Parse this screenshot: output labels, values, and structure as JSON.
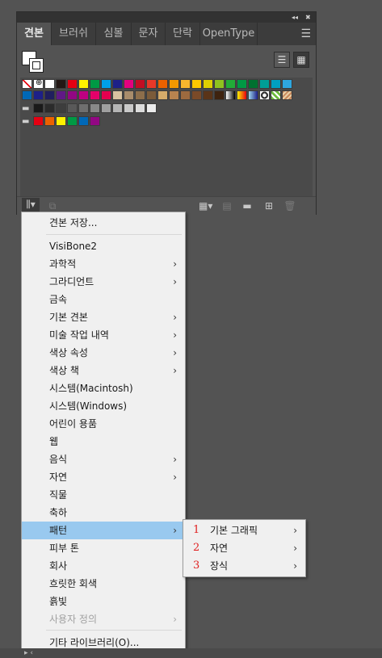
{
  "panel": {
    "tabs": [
      "견본",
      "브러쉬",
      "심볼",
      "문자",
      "단락",
      "OpenType"
    ],
    "active_tab": 0,
    "collapse_icon": "double-chevron-icon",
    "close_icon": "close-icon",
    "menu_icon": "hamburger-menu-icon",
    "swatch_rows": [
      [
        "none",
        "reg",
        "#ffffff",
        "#231815",
        "#e60012",
        "#fff100",
        "#009944",
        "#00a0e9",
        "#1d2088",
        "#e4007f",
        "#c30d23",
        "#e83828",
        "#eb6100",
        "#f39800",
        "#f8b62d",
        "#fcc800",
        "#dfd000",
        "#8fc31f",
        "#22ac38",
        "#009944",
        "#007130",
        "#009e96",
        "#00a0c1",
        "#2ea7e0"
      ],
      [
        "#0068b7",
        "#1d2088",
        "#201f5e",
        "#601986",
        "#920783",
        "#be0081",
        "#e5006a",
        "#e5004f",
        "#d9c3a0",
        "#a88c6b",
        "#8d6e4b",
        "#7b5b3a",
        "#d6ac6a",
        "#b8834f",
        "#9d6a3f",
        "#7a4a28",
        "#5a3418",
        "#3e230f",
        "grad1",
        "grad2",
        "grad3",
        "pat1",
        "pat2",
        "pat3"
      ],
      [
        "folder",
        "#1a1a1a",
        "#2b2b2b",
        "#3d3d3d",
        "#595959",
        "#6f6f6f",
        "#898989",
        "#9f9f9f",
        "#b5b5b5",
        "#c9c9c9",
        "#dcdcdc",
        "#ececec"
      ],
      [
        "folder",
        "#e60012",
        "#eb6100",
        "#fff100",
        "#009944",
        "#0068b7",
        "#920783"
      ]
    ]
  },
  "menu": {
    "items": [
      {
        "label": "견본 저장...",
        "sub": false
      },
      {
        "label": "VisiBone2",
        "sub": false
      },
      {
        "label": "과학적",
        "sub": true
      },
      {
        "label": "그라디언트",
        "sub": true
      },
      {
        "label": "금속",
        "sub": false
      },
      {
        "label": "기본 견본",
        "sub": true
      },
      {
        "label": "미술 작업 내역",
        "sub": true
      },
      {
        "label": "색상 속성",
        "sub": true
      },
      {
        "label": "색상 책",
        "sub": true
      },
      {
        "label": "시스템(Macintosh)",
        "sub": false
      },
      {
        "label": "시스템(Windows)",
        "sub": false
      },
      {
        "label": "어린이 용품",
        "sub": false
      },
      {
        "label": "웹",
        "sub": false
      },
      {
        "label": "음식",
        "sub": true
      },
      {
        "label": "자연",
        "sub": true
      },
      {
        "label": "직물",
        "sub": false
      },
      {
        "label": "축하",
        "sub": false
      },
      {
        "label": "패턴",
        "sub": true
      },
      {
        "label": "피부 톤",
        "sub": false
      },
      {
        "label": "회사",
        "sub": false
      },
      {
        "label": "흐릿한 회색",
        "sub": false
      },
      {
        "label": "흙빛",
        "sub": false
      },
      {
        "label": "사용자 정의",
        "sub": true
      },
      {
        "label": "기타 라이브러리(O)...",
        "sub": false
      }
    ],
    "arrow": "›"
  },
  "submenu": {
    "items": [
      {
        "num": "1",
        "label": "기본 그래픽"
      },
      {
        "num": "2",
        "label": "자연"
      },
      {
        "num": "3",
        "label": "장식"
      }
    ],
    "arrow": "›"
  },
  "colors": {
    "highlight": "#99c9ef",
    "annotation_red": "#e02020"
  }
}
